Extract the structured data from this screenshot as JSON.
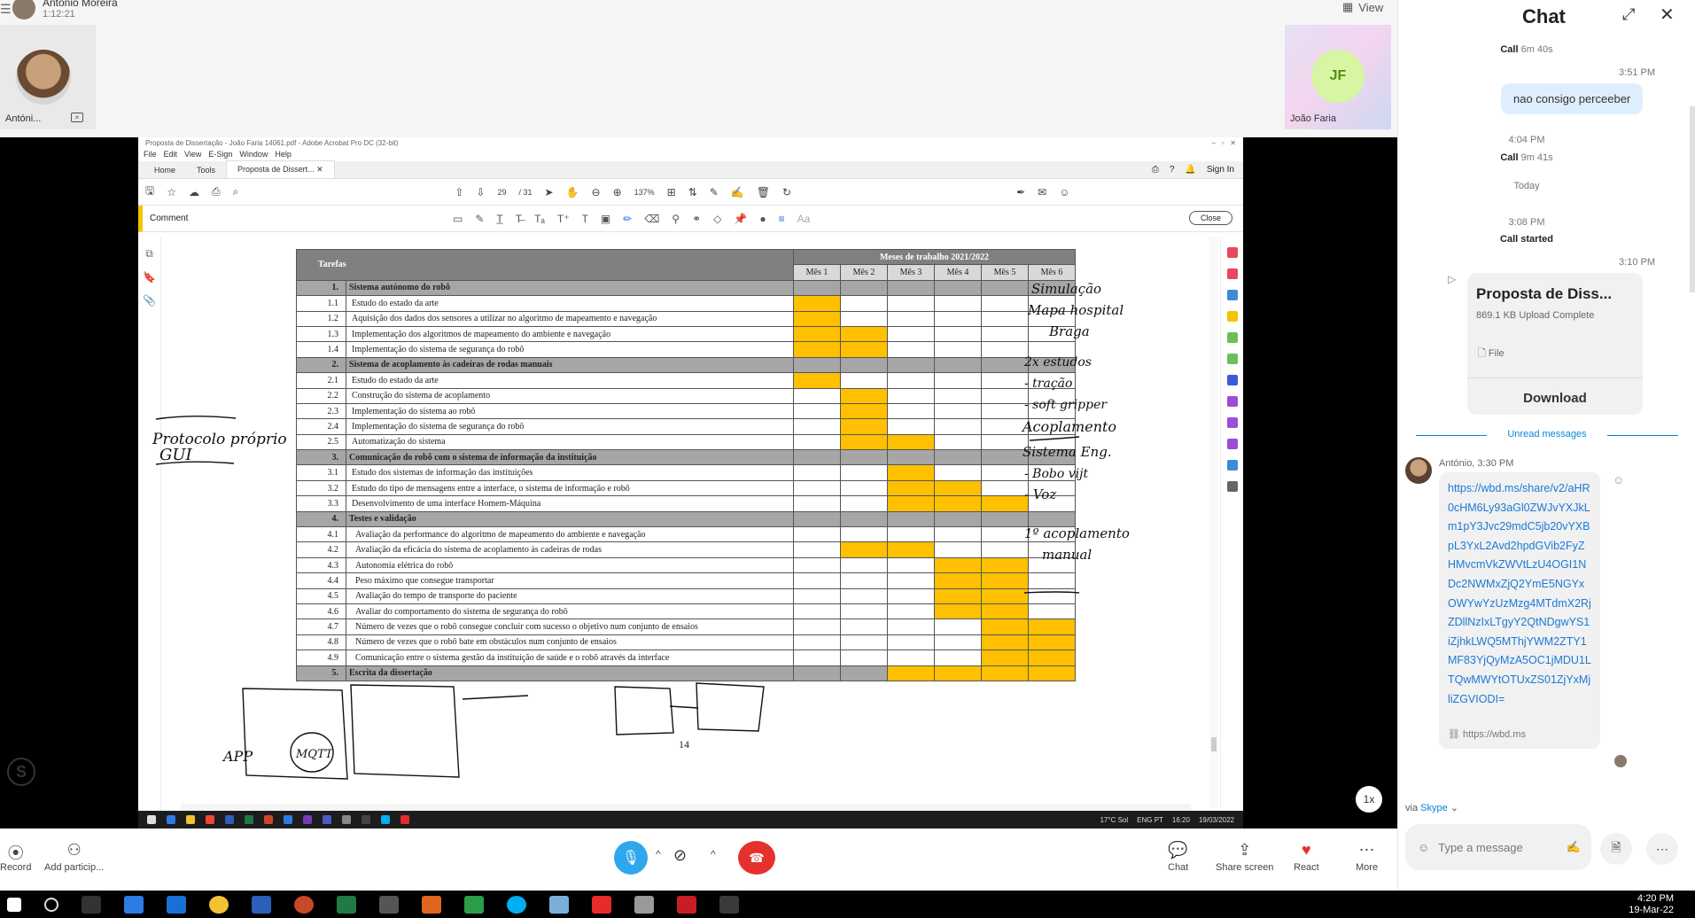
{
  "call": {
    "caller_name": "António Moreira",
    "duration": "1:12:21",
    "view_label": "View",
    "participants": [
      {
        "label": "Antóni...",
        "initials": ""
      },
      {
        "label": "João Faria",
        "initials": "JF"
      }
    ]
  },
  "acrobat": {
    "window_title": "Proposta de Dissertação - João Faria 14061.pdf - Adobe Acrobat Pro DC (32-bit)",
    "menu": [
      "File",
      "Edit",
      "View",
      "E-Sign",
      "Window",
      "Help"
    ],
    "tabs": [
      "Home",
      "Tools",
      "Proposta de Dissert..."
    ],
    "sign_in": "Sign In",
    "page_current": "29",
    "page_total": "/ 31",
    "zoom": "137%",
    "comment_label": "Comment",
    "close_label": "Close",
    "page_number": "14"
  },
  "gantt": {
    "header_tasks": "Tarefas",
    "header_months_group": "Meses de trabalho 2021/2022",
    "months": [
      "Mês 1",
      "Mês 2",
      "Mês 3",
      "Mês 4",
      "Mês 5",
      "Mês 6"
    ],
    "rows": [
      {
        "type": "section",
        "num": "1.",
        "label": "Sistema autónomo do robô",
        "active": []
      },
      {
        "type": "task",
        "num": "1.1",
        "label": "Estudo do estado da arte",
        "active": [
          1
        ]
      },
      {
        "type": "task",
        "num": "1.2",
        "label": "Aquisição dos dados dos sensores a utilizar no algoritmo de mapeamento e navegação",
        "active": [
          1
        ]
      },
      {
        "type": "task",
        "num": "1.3",
        "label": "Implementação dos algoritmos de mapeamento do ambiente e navegação",
        "active": [
          1,
          2
        ]
      },
      {
        "type": "task",
        "num": "1.4",
        "label": "Implementação do sistema de segurança do robô",
        "active": [
          1,
          2
        ]
      },
      {
        "type": "section",
        "num": "2.",
        "label": "Sistema de acoplamento às cadeiras de rodas manuais",
        "active": []
      },
      {
        "type": "task",
        "num": "2.1",
        "label": "Estudo do estado da arte",
        "active": [
          1
        ]
      },
      {
        "type": "task",
        "num": "2.2",
        "label": "Construção do sistema de acoplamento",
        "active": [
          2
        ]
      },
      {
        "type": "task",
        "num": "2.3",
        "label": "Implementação do sistema ao robô",
        "active": [
          2
        ]
      },
      {
        "type": "task",
        "num": "2.4",
        "label": "Implementação do sistema de segurança do robô",
        "active": [
          2
        ]
      },
      {
        "type": "task",
        "num": "2.5",
        "label": "Automatização do sistema",
        "active": [
          2,
          3
        ]
      },
      {
        "type": "section",
        "num": "3.",
        "label": "Comunicação do robô com o sistema de informação da instituição",
        "active": []
      },
      {
        "type": "task",
        "num": "3.1",
        "label": "Estudo dos sistemas de informação das instituições",
        "active": [
          3
        ]
      },
      {
        "type": "task",
        "num": "3.2",
        "label": "Estudo do tipo de mensagens entre a interface, o sistema de informação e robô",
        "active": [
          3,
          4
        ]
      },
      {
        "type": "task",
        "num": "3.3",
        "label": "Desenvolvimento de uma interface Homem-Máquina",
        "active": [
          3,
          4,
          5
        ]
      },
      {
        "type": "section",
        "num": "4.",
        "label": "Testes e validação",
        "active": []
      },
      {
        "type": "task",
        "num": "4.1",
        "label": "Avaliação da performance do algoritmo de mapeamento do ambiente e navegação",
        "active": []
      },
      {
        "type": "task",
        "num": "4.2",
        "label": "Avaliação da eficácia do sistema de acoplamento às cadeiras de rodas",
        "active": [
          2,
          3
        ]
      },
      {
        "type": "task",
        "num": "4.3",
        "label": "Autonomia elétrica do robô",
        "active": [
          4,
          5
        ]
      },
      {
        "type": "task",
        "num": "4.4",
        "label": "Peso máximo que consegue transportar",
        "active": [
          4,
          5
        ]
      },
      {
        "type": "task",
        "num": "4.5",
        "label": "Avaliação do tempo de transporte do paciente",
        "active": [
          4,
          5
        ]
      },
      {
        "type": "task",
        "num": "4.6",
        "label": "Avaliar do comportamento do sistema de segurança do robô",
        "active": [
          4,
          5
        ]
      },
      {
        "type": "task",
        "num": "4.7",
        "label": "Número de vezes que o robô consegue concluir com sucesso o objetivo num conjunto de ensaios",
        "active": [
          5,
          6
        ]
      },
      {
        "type": "task",
        "num": "4.8",
        "label": "Número de vezes que o robô bate em obstáculos num conjunto de ensaios",
        "active": [
          5,
          6
        ]
      },
      {
        "type": "task",
        "num": "4.9",
        "label": "Comunicação entre o sistema gestão da instituição de saúde e o robô através da interface",
        "active": [
          5,
          6
        ]
      },
      {
        "type": "section",
        "num": "5.",
        "label": "Escrita da dissertação",
        "active": [
          3,
          4,
          5,
          6
        ]
      }
    ]
  },
  "annotations": {
    "left_note": [
      "Protocolo próprio",
      "GUI"
    ],
    "right_notes": [
      "Simulação",
      "Mapa hospital",
      "Braga",
      "2x estudos",
      "- tração",
      "- soft gripper",
      "Acoplamento",
      "Sistema Eng.",
      "- Bobo vijt",
      "- Voz",
      "1º acoplamento",
      "manual"
    ],
    "bottom_left": [
      "APP",
      "MQTT"
    ]
  },
  "inner_taskbar": {
    "weather": "17°C Sol",
    "lang": "ENG PT",
    "time": "16:20",
    "date": "19/03/2022"
  },
  "controls": {
    "record": "Record",
    "add_participants": "Add particip...",
    "chat": "Chat",
    "share_screen": "Share screen",
    "react": "React",
    "more": "More",
    "speed": "1x"
  },
  "chat": {
    "title": "Chat",
    "call1": {
      "label": "Call",
      "duration": "6m 40s"
    },
    "msg_time1": "3:51 PM",
    "my_message": "nao consigo perceeber",
    "time2": "4:04 PM",
    "call2": {
      "label": "Call",
      "duration": "9m 41s"
    },
    "today": "Today",
    "time3": "3:08 PM",
    "call_started": "Call started",
    "time4": "3:10 PM",
    "file_name": "Proposta de Diss...",
    "file_status": "869.1 KB Upload Complete",
    "file_label": "File",
    "download": "Download",
    "unread": "Unread messages",
    "sender_line": "António, 3:30 PM",
    "link": "https://wbd.ms/share/v2/aHR0cHM6Ly93aGl0ZWJvYXJkLm1pY3Jvc29mdC5jb20vYXBpL3YxL2Avd2hpdGVib2FyZHMvcmVkZWVtLzU4OGI1NDc2NWMxZjQ2YmE5NGYxOWYwYzUzMzg4MTdmX2RjZDllNzIxLTgyY2QtNDgwYS1iZjhkLWQ5MThjYWM2ZTY1MF83YjQyMzA5OC1jMDU1LTQwMWYtOTUxZS01ZjYxMjliZGVIODI=",
    "link_short": "https://wbd.ms",
    "via": "via",
    "via_app": "Skype",
    "input_placeholder": "Type a message"
  },
  "taskbar": {
    "time": "4:20 PM",
    "date": "19-Mar-22"
  }
}
